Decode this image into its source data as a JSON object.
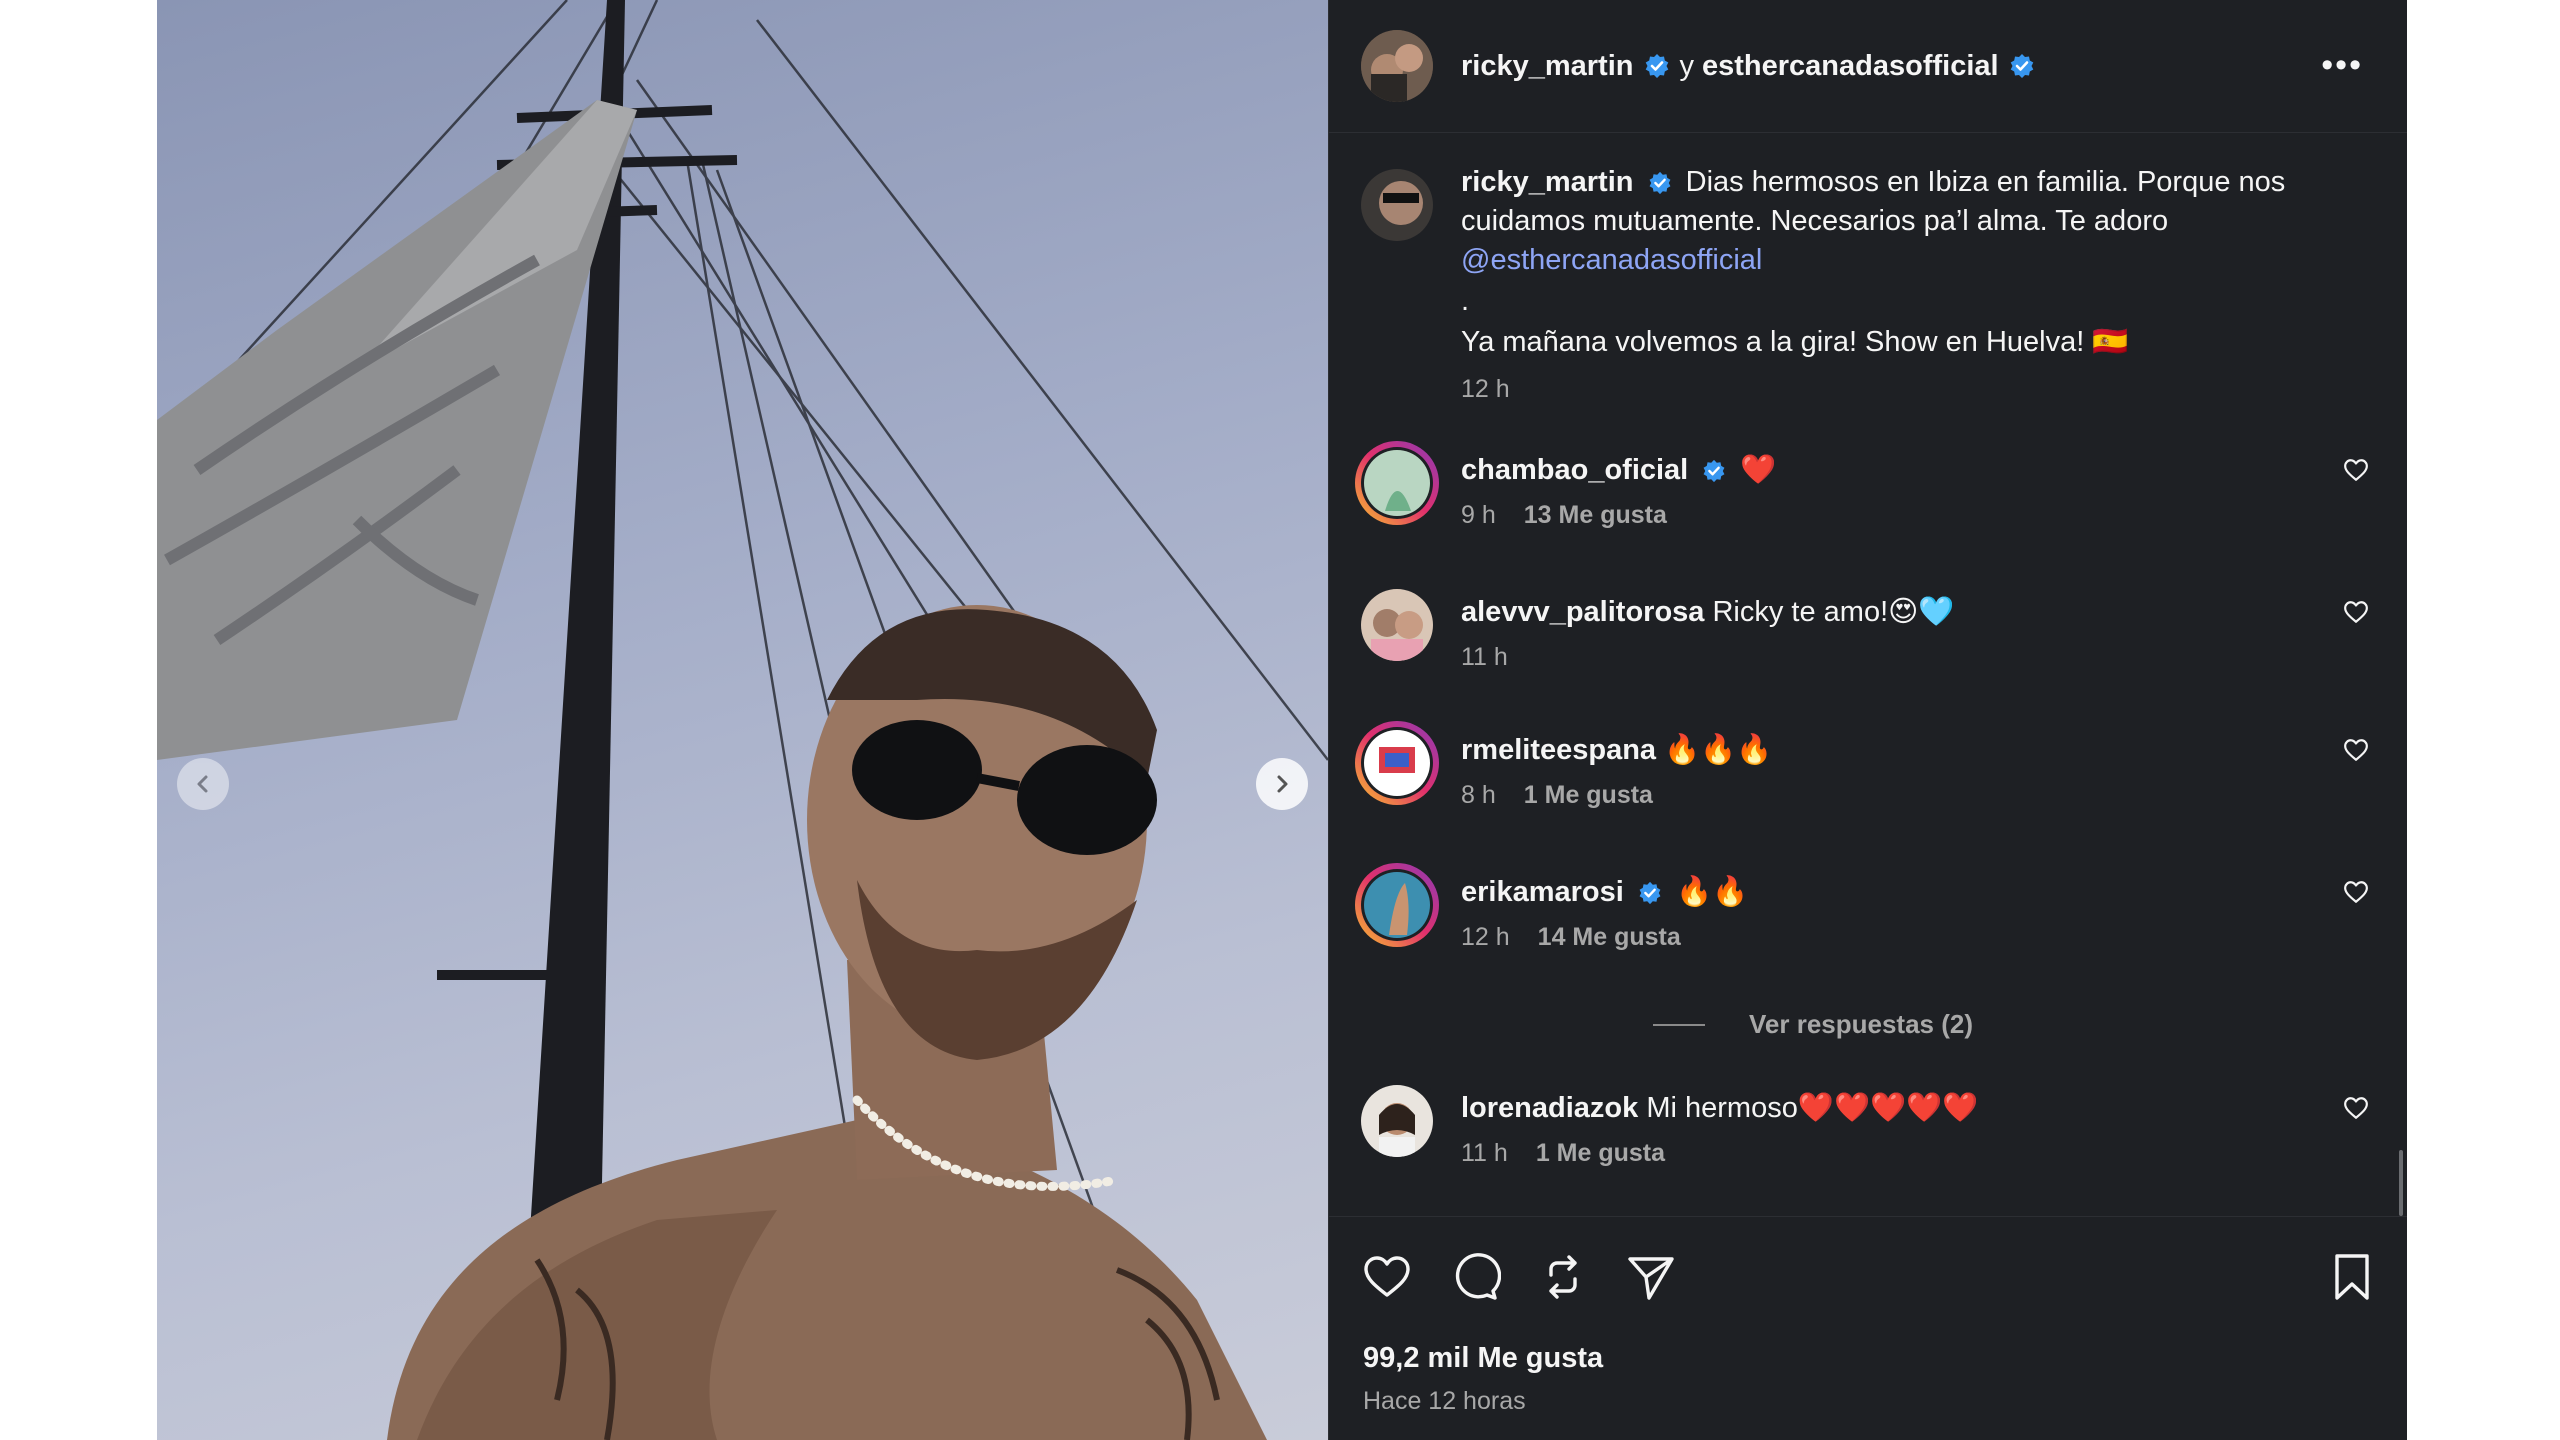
{
  "post": {
    "authors": {
      "primary": "ricky_martin",
      "connector": "y",
      "secondary": "esthercanadasofficial"
    },
    "more_label": "•••",
    "caption": {
      "user": "ricky_martin",
      "text": "Dias hermosos en Ibiza en familia. Porque nos cuidamos mutuamente. Necesarios pa’l alma. Te adoro",
      "mention": "@esthercanadasofficial",
      "dot": ".",
      "line2": "Ya mañana volvemos a la gira! Show en Huelva! 🇪🇸",
      "time": "12 h"
    },
    "comments": [
      {
        "user": "chambao_oficial",
        "verified": true,
        "text": "❤️",
        "time": "9 h",
        "likes": "13 Me gusta"
      },
      {
        "user": "alevvv_palitorosa",
        "verified": false,
        "text": "Ricky te amo!😍🩵",
        "time": "11 h",
        "likes": ""
      },
      {
        "user": "rmeliteespana",
        "verified": false,
        "text": "🔥🔥🔥",
        "time": "8 h",
        "likes": "1 Me gusta"
      },
      {
        "user": "erikamarosi",
        "verified": true,
        "text": "🔥🔥",
        "time": "12 h",
        "likes": "14 Me gusta"
      },
      {
        "user": "lorenadiazok",
        "verified": false,
        "text": "Mi hermoso❤️❤️❤️❤️❤️",
        "time": "11 h",
        "likes": "1 Me gusta"
      }
    ],
    "view_replies": "Ver respuestas (2)",
    "likes_total": "99,2 mil Me gusta",
    "posted_ago": "Hace 12 horas"
  },
  "colors": {
    "panel_bg": "#1e2024",
    "verified_blue": "#3897f0",
    "mention_blue": "#8ea5f5",
    "muted_text": "#a8a8a8"
  },
  "icons": {
    "header": [
      "verified-icon",
      "more-options-icon"
    ],
    "actions": [
      "heart-icon",
      "comment-icon",
      "repost-icon",
      "share-icon",
      "bookmark-icon"
    ],
    "carousel": [
      "chevron-left-icon",
      "chevron-right-icon"
    ]
  }
}
